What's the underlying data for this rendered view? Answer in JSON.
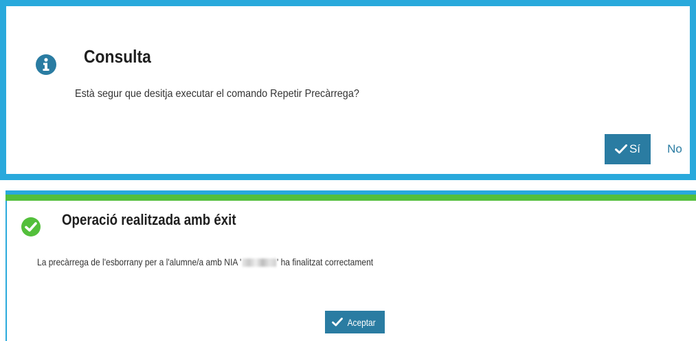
{
  "dialog_confirm": {
    "title": "Consulta",
    "message": "Està segur que desitja executar el comando Repetir Precàrrega?",
    "icon": "info-icon",
    "yes_label": "Sí",
    "no_label": "No"
  },
  "dialog_success": {
    "title": "Operació realitzada amb éxit",
    "message_prefix": "La precàrrega de l'esborrany per a l'alumne/a amb NIA '",
    "message_suffix": "' ha finalitzat correctament",
    "icon": "check-circle-icon",
    "accept_label": "Aceptar"
  },
  "colors": {
    "accent_blue": "#29a9dc",
    "button_blue": "#2a7ca2",
    "success_green": "#53bf3b"
  }
}
